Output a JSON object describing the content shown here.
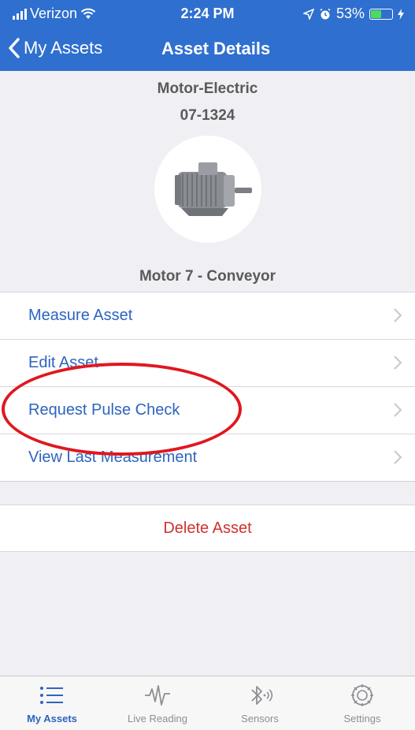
{
  "status_bar": {
    "carrier": "Verizon",
    "time": "2:24 PM",
    "battery": "53%",
    "battery_level": 0.53
  },
  "nav": {
    "back_label": "My Assets",
    "title": "Asset Details"
  },
  "asset": {
    "type": "Motor-Electric",
    "id": "07-1324",
    "name": "Motor 7 - Conveyor",
    "image_icon": "electric-motor-photo"
  },
  "menu": {
    "items": [
      {
        "label": "Measure Asset"
      },
      {
        "label": "Edit Asset"
      },
      {
        "label": "Request Pulse Check"
      },
      {
        "label": "View Last Measurement"
      }
    ]
  },
  "actions": {
    "delete_label": "Delete Asset"
  },
  "tabs": [
    {
      "label": "My Assets",
      "icon": "list-icon",
      "active": true
    },
    {
      "label": "Live Reading",
      "icon": "waveform-icon",
      "active": false
    },
    {
      "label": "Sensors",
      "icon": "bluetooth-icon",
      "active": false
    },
    {
      "label": "Settings",
      "icon": "gear-icon",
      "active": false
    }
  ],
  "colors": {
    "nav_blue": "#2f6fcf",
    "link_blue": "#2e64c0",
    "destructive_red": "#d0312d",
    "annotation_red": "#e0171f"
  }
}
